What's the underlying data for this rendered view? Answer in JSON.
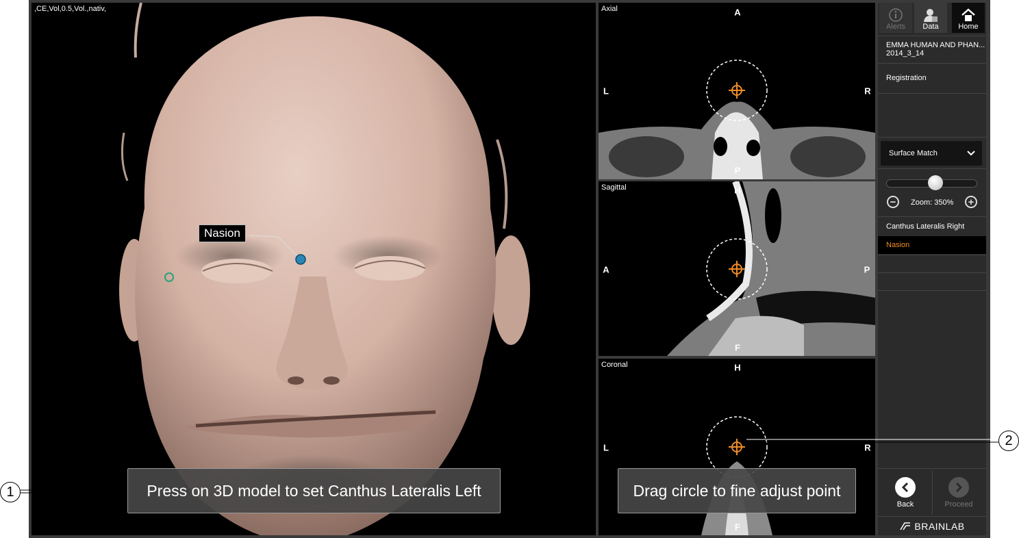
{
  "viewer_3d": {
    "info_label": ",CE,Vol,0.5,Vol.,nativ,",
    "landmark_label": "Nasion",
    "instruction": "Press on 3D model to set Canthus Lateralis Left"
  },
  "slices": {
    "axial": {
      "name": "Axial",
      "top": "A",
      "bottom": "P",
      "left": "L",
      "right": "R"
    },
    "sagittal": {
      "name": "Sagittal",
      "top": "H",
      "bottom": "F",
      "left": "A",
      "right": "P"
    },
    "coronal": {
      "name": "Coronal",
      "top": "H",
      "bottom": "F",
      "left": "L",
      "right": "R"
    },
    "instruction": "Drag circle to fine adjust point"
  },
  "callouts": {
    "one": "1",
    "two": "2"
  },
  "sidebar": {
    "alerts_label": "Alerts",
    "data_label": "Data",
    "home_label": "Home",
    "patient_name": "EMMA HUMAN AND PHAN...",
    "patient_date": "2014_3_14",
    "section": "Registration",
    "method": "Surface Match",
    "zoom_label": "Zoom: 350%",
    "zoom_level": 0.55,
    "points": [
      "Canthus Lateralis Right",
      "Nasion"
    ],
    "active_point_color": "#f08c28",
    "back_label": "Back",
    "proceed_label": "Proceed",
    "brand": "BRAINLAB"
  }
}
